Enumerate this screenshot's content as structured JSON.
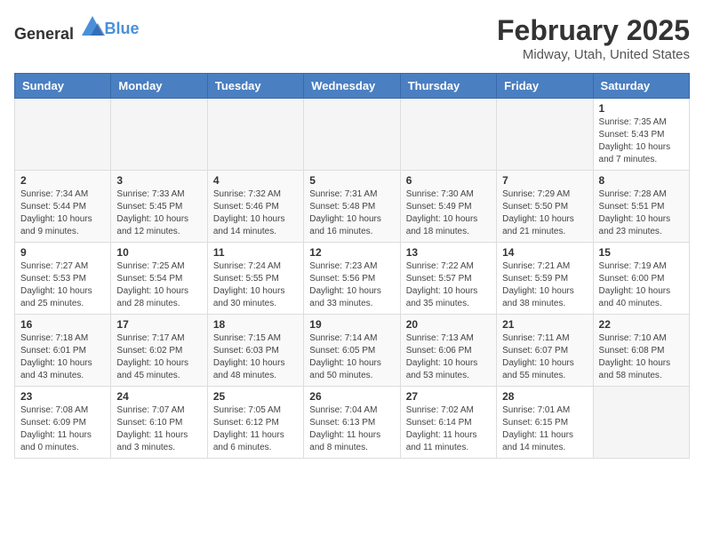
{
  "header": {
    "logo_general": "General",
    "logo_blue": "Blue",
    "month": "February 2025",
    "location": "Midway, Utah, United States"
  },
  "weekdays": [
    "Sunday",
    "Monday",
    "Tuesday",
    "Wednesday",
    "Thursday",
    "Friday",
    "Saturday"
  ],
  "weeks": [
    [
      {
        "day": "",
        "info": ""
      },
      {
        "day": "",
        "info": ""
      },
      {
        "day": "",
        "info": ""
      },
      {
        "day": "",
        "info": ""
      },
      {
        "day": "",
        "info": ""
      },
      {
        "day": "",
        "info": ""
      },
      {
        "day": "1",
        "info": "Sunrise: 7:35 AM\nSunset: 5:43 PM\nDaylight: 10 hours and 7 minutes."
      }
    ],
    [
      {
        "day": "2",
        "info": "Sunrise: 7:34 AM\nSunset: 5:44 PM\nDaylight: 10 hours and 9 minutes."
      },
      {
        "day": "3",
        "info": "Sunrise: 7:33 AM\nSunset: 5:45 PM\nDaylight: 10 hours and 12 minutes."
      },
      {
        "day": "4",
        "info": "Sunrise: 7:32 AM\nSunset: 5:46 PM\nDaylight: 10 hours and 14 minutes."
      },
      {
        "day": "5",
        "info": "Sunrise: 7:31 AM\nSunset: 5:48 PM\nDaylight: 10 hours and 16 minutes."
      },
      {
        "day": "6",
        "info": "Sunrise: 7:30 AM\nSunset: 5:49 PM\nDaylight: 10 hours and 18 minutes."
      },
      {
        "day": "7",
        "info": "Sunrise: 7:29 AM\nSunset: 5:50 PM\nDaylight: 10 hours and 21 minutes."
      },
      {
        "day": "8",
        "info": "Sunrise: 7:28 AM\nSunset: 5:51 PM\nDaylight: 10 hours and 23 minutes."
      }
    ],
    [
      {
        "day": "9",
        "info": "Sunrise: 7:27 AM\nSunset: 5:53 PM\nDaylight: 10 hours and 25 minutes."
      },
      {
        "day": "10",
        "info": "Sunrise: 7:25 AM\nSunset: 5:54 PM\nDaylight: 10 hours and 28 minutes."
      },
      {
        "day": "11",
        "info": "Sunrise: 7:24 AM\nSunset: 5:55 PM\nDaylight: 10 hours and 30 minutes."
      },
      {
        "day": "12",
        "info": "Sunrise: 7:23 AM\nSunset: 5:56 PM\nDaylight: 10 hours and 33 minutes."
      },
      {
        "day": "13",
        "info": "Sunrise: 7:22 AM\nSunset: 5:57 PM\nDaylight: 10 hours and 35 minutes."
      },
      {
        "day": "14",
        "info": "Sunrise: 7:21 AM\nSunset: 5:59 PM\nDaylight: 10 hours and 38 minutes."
      },
      {
        "day": "15",
        "info": "Sunrise: 7:19 AM\nSunset: 6:00 PM\nDaylight: 10 hours and 40 minutes."
      }
    ],
    [
      {
        "day": "16",
        "info": "Sunrise: 7:18 AM\nSunset: 6:01 PM\nDaylight: 10 hours and 43 minutes."
      },
      {
        "day": "17",
        "info": "Sunrise: 7:17 AM\nSunset: 6:02 PM\nDaylight: 10 hours and 45 minutes."
      },
      {
        "day": "18",
        "info": "Sunrise: 7:15 AM\nSunset: 6:03 PM\nDaylight: 10 hours and 48 minutes."
      },
      {
        "day": "19",
        "info": "Sunrise: 7:14 AM\nSunset: 6:05 PM\nDaylight: 10 hours and 50 minutes."
      },
      {
        "day": "20",
        "info": "Sunrise: 7:13 AM\nSunset: 6:06 PM\nDaylight: 10 hours and 53 minutes."
      },
      {
        "day": "21",
        "info": "Sunrise: 7:11 AM\nSunset: 6:07 PM\nDaylight: 10 hours and 55 minutes."
      },
      {
        "day": "22",
        "info": "Sunrise: 7:10 AM\nSunset: 6:08 PM\nDaylight: 10 hours and 58 minutes."
      }
    ],
    [
      {
        "day": "23",
        "info": "Sunrise: 7:08 AM\nSunset: 6:09 PM\nDaylight: 11 hours and 0 minutes."
      },
      {
        "day": "24",
        "info": "Sunrise: 7:07 AM\nSunset: 6:10 PM\nDaylight: 11 hours and 3 minutes."
      },
      {
        "day": "25",
        "info": "Sunrise: 7:05 AM\nSunset: 6:12 PM\nDaylight: 11 hours and 6 minutes."
      },
      {
        "day": "26",
        "info": "Sunrise: 7:04 AM\nSunset: 6:13 PM\nDaylight: 11 hours and 8 minutes."
      },
      {
        "day": "27",
        "info": "Sunrise: 7:02 AM\nSunset: 6:14 PM\nDaylight: 11 hours and 11 minutes."
      },
      {
        "day": "28",
        "info": "Sunrise: 7:01 AM\nSunset: 6:15 PM\nDaylight: 11 hours and 14 minutes."
      },
      {
        "day": "",
        "info": ""
      }
    ]
  ]
}
